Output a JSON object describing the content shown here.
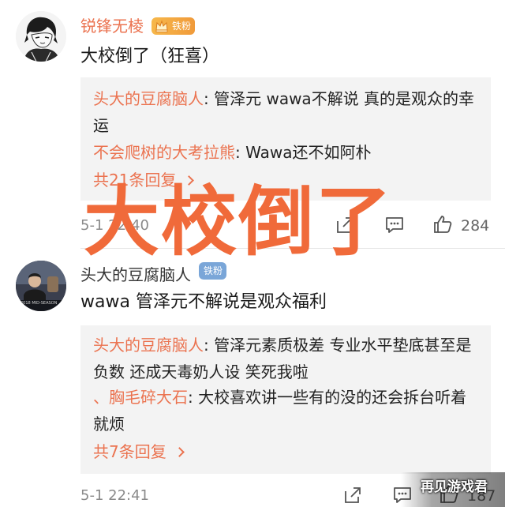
{
  "comments": [
    {
      "username": "锐锋无棱",
      "badge": "铁粉",
      "text": "大校倒了（狂喜）",
      "replies": [
        {
          "name": "头大的豆腐脑人",
          "sep": ": ",
          "text": "管泽元 wawa不解说 真的是观众的幸运"
        },
        {
          "name": "不会爬树的大考拉熊",
          "sep": ": ",
          "text": "Wawa还不如阿朴"
        }
      ],
      "reply_count": "共21条回复",
      "time": "5-1 22:40",
      "likes": "284"
    },
    {
      "username": "头大的豆腐脑人",
      "badge": "铁粉",
      "avatar_caption": "2018 MID-SEASON",
      "text": "wawa 管泽元不解说是观众福利",
      "replies": [
        {
          "name": "头大的豆腐脑人",
          "sep": ": ",
          "text": "管泽元素质极差 专业水平垫底甚至是负数 还成天毒奶人设 笑死我啦"
        },
        {
          "name": "、胸毛碎大石",
          "sep": ": ",
          "text": "大校喜欢讲一些有的没的还会拆台听着就烦"
        }
      ],
      "reply_count": "共7条回复",
      "time": "5-1 22:41",
      "likes": "187"
    }
  ],
  "overlay": "大校倒了",
  "watermark": "再见游戏君",
  "colors": {
    "accent": "#eb7350",
    "overlay": "#f06a3a",
    "reply_bg": "#f3f3f3",
    "badge": "#f3a93f"
  },
  "icons": [
    "share-icon",
    "comment-icon",
    "like-icon",
    "chevron-right-icon",
    "crown-icon"
  ]
}
